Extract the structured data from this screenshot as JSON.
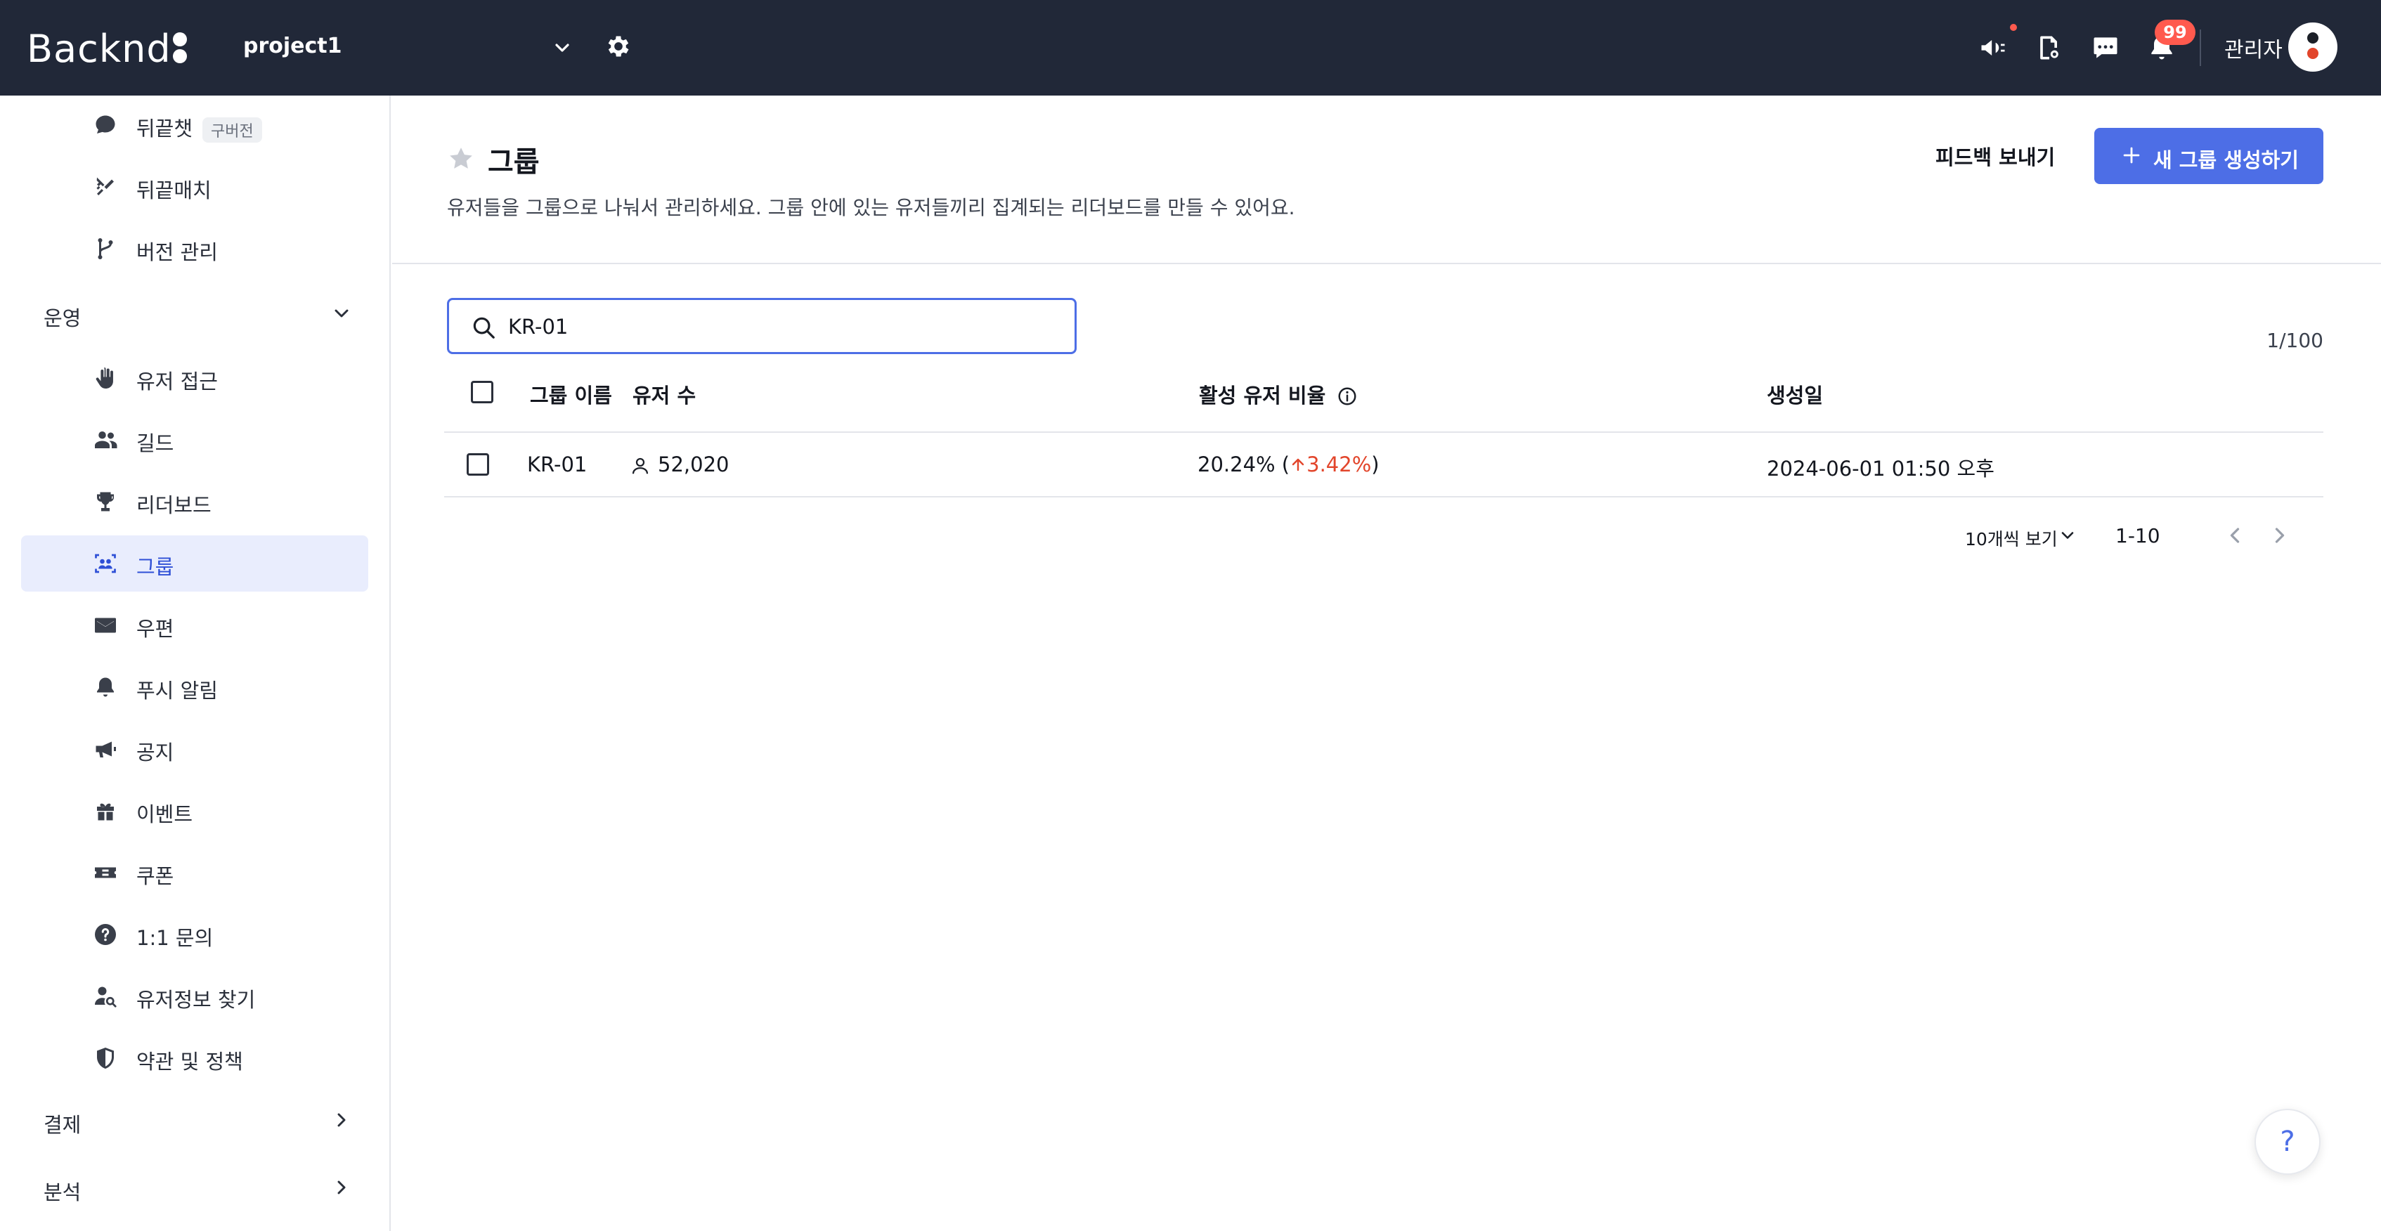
{
  "topbar": {
    "logo": "Backnd",
    "project_name": "project1",
    "notification_count": "99",
    "admin_label": "관리자",
    "icons": [
      "megaphone-icon",
      "developer-icon",
      "chat-icon",
      "bell-icon"
    ]
  },
  "sidebar": {
    "top_items": [
      {
        "label": "뒤끝챗",
        "tag": "구버전",
        "icon": "chat-bubble-icon"
      },
      {
        "label": "뒤끝매치",
        "icon": "crossed-swords-icon"
      },
      {
        "label": "버전 관리",
        "icon": "branch-icon"
      }
    ],
    "section_ops": "운영",
    "ops_items": [
      {
        "label": "유저 접근",
        "icon": "hand-icon"
      },
      {
        "label": "길드",
        "icon": "people-icon"
      },
      {
        "label": "리더보드",
        "icon": "trophy-icon"
      },
      {
        "label": "그룹",
        "icon": "group-icon",
        "active": true
      },
      {
        "label": "우편",
        "icon": "mail-icon"
      },
      {
        "label": "푸시 알림",
        "icon": "bell-icon"
      },
      {
        "label": "공지",
        "icon": "megaphone-icon"
      },
      {
        "label": "이벤트",
        "icon": "gift-icon"
      },
      {
        "label": "쿠폰",
        "icon": "ticket-icon"
      },
      {
        "label": "1:1 문의",
        "icon": "question-icon"
      },
      {
        "label": "유저정보 찾기",
        "icon": "user-search-icon"
      },
      {
        "label": "약관 및 정책",
        "icon": "shield-icon"
      }
    ],
    "section_payment": "결제",
    "section_analytics": "분석"
  },
  "page": {
    "title": "그룹",
    "description": "유저들을 그룹으로 나눠서 관리하세요. 그룹 안에 있는 유저들끼리 집계되는 리더보드를 만들 수 있어요.",
    "feedback_label": "피드백 보내기",
    "create_label": "새 그룹 생성하기"
  },
  "search": {
    "value": "KR-01",
    "placeholder": ""
  },
  "result_count": "1/100",
  "table": {
    "headers": {
      "name": "그룹 이름",
      "users": "유저 수",
      "active_ratio": "활성 유저 비율",
      "created": "생성일"
    },
    "rows": [
      {
        "name": "KR-01",
        "users": "52,020",
        "active_ratio": "20.24%",
        "change": "3.42%",
        "created": "2024-06-01 01:50 오후"
      }
    ]
  },
  "pagination": {
    "per_page": "10개씩 보기",
    "range": "1-10"
  },
  "help_label": "?",
  "colors": {
    "topbar": "#212838",
    "accent": "#4d6ee6",
    "active_bg": "#e9edfd",
    "badge": "#ff5a4e",
    "increase": "#e2452b"
  }
}
